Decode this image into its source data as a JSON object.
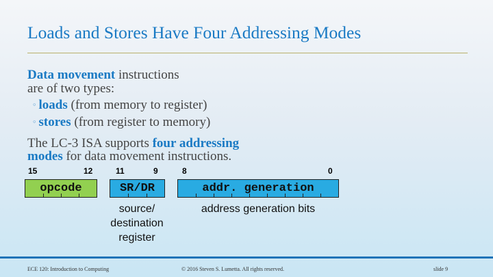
{
  "slide": {
    "title": "Loads and Stores Have Four Addressing Modes"
  },
  "intro": {
    "emphasis": "Data movement",
    "line1_rest": " instructions",
    "line2": "are of two types:"
  },
  "bullets": [
    {
      "bold": "loads",
      "rest": " (from memory to register)"
    },
    {
      "bold": "stores",
      "rest": " (from register to memory)"
    }
  ],
  "support": {
    "prefix": "The LC-3 ISA supports ",
    "emphasis_line1": "four addressing",
    "emphasis_line2": "modes",
    "suffix": " for data movement instructions."
  },
  "instruction_format": {
    "bit_numbers": {
      "opcode_high": "15",
      "opcode_low": "12",
      "reg_high": "11",
      "reg_low": "9",
      "addr_high": "8",
      "addr_low": "0"
    },
    "fields": {
      "opcode": {
        "label": "opcode",
        "color": "#92d050"
      },
      "register": {
        "label": "SR/DR",
        "color": "#29abe2"
      },
      "address": {
        "label": "addr. generation",
        "color": "#29abe2"
      }
    },
    "captions": {
      "register_line1": "source/",
      "register_line2": "destination",
      "register_line3": "register",
      "address": "address generation bits"
    }
  },
  "footer": {
    "course": "ECE 120: Introduction to Computing",
    "copyright": "© 2016 Steven S. Lumetta.  All rights reserved.",
    "slide_number": "slide 9",
    "bar_color": "#1f73b7"
  }
}
